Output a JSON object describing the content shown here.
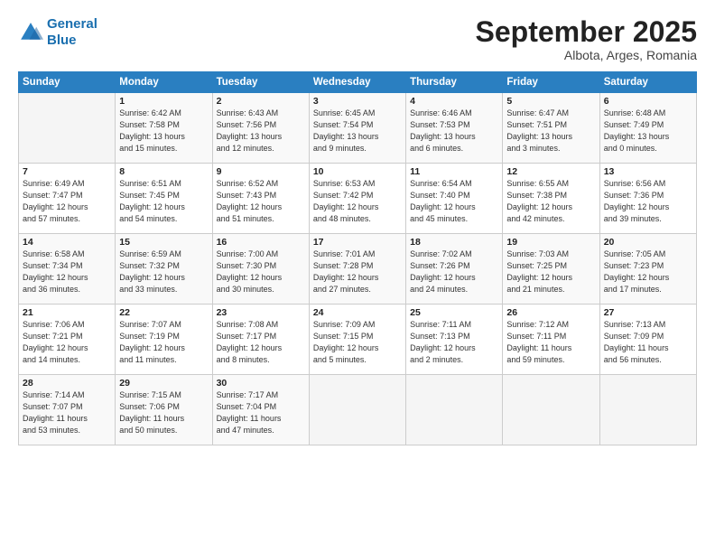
{
  "header": {
    "logo_line1": "General",
    "logo_line2": "Blue",
    "month": "September 2025",
    "location": "Albota, Arges, Romania"
  },
  "weekdays": [
    "Sunday",
    "Monday",
    "Tuesday",
    "Wednesday",
    "Thursday",
    "Friday",
    "Saturday"
  ],
  "weeks": [
    [
      {
        "day": "",
        "info": ""
      },
      {
        "day": "1",
        "info": "Sunrise: 6:42 AM\nSunset: 7:58 PM\nDaylight: 13 hours\nand 15 minutes."
      },
      {
        "day": "2",
        "info": "Sunrise: 6:43 AM\nSunset: 7:56 PM\nDaylight: 13 hours\nand 12 minutes."
      },
      {
        "day": "3",
        "info": "Sunrise: 6:45 AM\nSunset: 7:54 PM\nDaylight: 13 hours\nand 9 minutes."
      },
      {
        "day": "4",
        "info": "Sunrise: 6:46 AM\nSunset: 7:53 PM\nDaylight: 13 hours\nand 6 minutes."
      },
      {
        "day": "5",
        "info": "Sunrise: 6:47 AM\nSunset: 7:51 PM\nDaylight: 13 hours\nand 3 minutes."
      },
      {
        "day": "6",
        "info": "Sunrise: 6:48 AM\nSunset: 7:49 PM\nDaylight: 13 hours\nand 0 minutes."
      }
    ],
    [
      {
        "day": "7",
        "info": "Sunrise: 6:49 AM\nSunset: 7:47 PM\nDaylight: 12 hours\nand 57 minutes."
      },
      {
        "day": "8",
        "info": "Sunrise: 6:51 AM\nSunset: 7:45 PM\nDaylight: 12 hours\nand 54 minutes."
      },
      {
        "day": "9",
        "info": "Sunrise: 6:52 AM\nSunset: 7:43 PM\nDaylight: 12 hours\nand 51 minutes."
      },
      {
        "day": "10",
        "info": "Sunrise: 6:53 AM\nSunset: 7:42 PM\nDaylight: 12 hours\nand 48 minutes."
      },
      {
        "day": "11",
        "info": "Sunrise: 6:54 AM\nSunset: 7:40 PM\nDaylight: 12 hours\nand 45 minutes."
      },
      {
        "day": "12",
        "info": "Sunrise: 6:55 AM\nSunset: 7:38 PM\nDaylight: 12 hours\nand 42 minutes."
      },
      {
        "day": "13",
        "info": "Sunrise: 6:56 AM\nSunset: 7:36 PM\nDaylight: 12 hours\nand 39 minutes."
      }
    ],
    [
      {
        "day": "14",
        "info": "Sunrise: 6:58 AM\nSunset: 7:34 PM\nDaylight: 12 hours\nand 36 minutes."
      },
      {
        "day": "15",
        "info": "Sunrise: 6:59 AM\nSunset: 7:32 PM\nDaylight: 12 hours\nand 33 minutes."
      },
      {
        "day": "16",
        "info": "Sunrise: 7:00 AM\nSunset: 7:30 PM\nDaylight: 12 hours\nand 30 minutes."
      },
      {
        "day": "17",
        "info": "Sunrise: 7:01 AM\nSunset: 7:28 PM\nDaylight: 12 hours\nand 27 minutes."
      },
      {
        "day": "18",
        "info": "Sunrise: 7:02 AM\nSunset: 7:26 PM\nDaylight: 12 hours\nand 24 minutes."
      },
      {
        "day": "19",
        "info": "Sunrise: 7:03 AM\nSunset: 7:25 PM\nDaylight: 12 hours\nand 21 minutes."
      },
      {
        "day": "20",
        "info": "Sunrise: 7:05 AM\nSunset: 7:23 PM\nDaylight: 12 hours\nand 17 minutes."
      }
    ],
    [
      {
        "day": "21",
        "info": "Sunrise: 7:06 AM\nSunset: 7:21 PM\nDaylight: 12 hours\nand 14 minutes."
      },
      {
        "day": "22",
        "info": "Sunrise: 7:07 AM\nSunset: 7:19 PM\nDaylight: 12 hours\nand 11 minutes."
      },
      {
        "day": "23",
        "info": "Sunrise: 7:08 AM\nSunset: 7:17 PM\nDaylight: 12 hours\nand 8 minutes."
      },
      {
        "day": "24",
        "info": "Sunrise: 7:09 AM\nSunset: 7:15 PM\nDaylight: 12 hours\nand 5 minutes."
      },
      {
        "day": "25",
        "info": "Sunrise: 7:11 AM\nSunset: 7:13 PM\nDaylight: 12 hours\nand 2 minutes."
      },
      {
        "day": "26",
        "info": "Sunrise: 7:12 AM\nSunset: 7:11 PM\nDaylight: 11 hours\nand 59 minutes."
      },
      {
        "day": "27",
        "info": "Sunrise: 7:13 AM\nSunset: 7:09 PM\nDaylight: 11 hours\nand 56 minutes."
      }
    ],
    [
      {
        "day": "28",
        "info": "Sunrise: 7:14 AM\nSunset: 7:07 PM\nDaylight: 11 hours\nand 53 minutes."
      },
      {
        "day": "29",
        "info": "Sunrise: 7:15 AM\nSunset: 7:06 PM\nDaylight: 11 hours\nand 50 minutes."
      },
      {
        "day": "30",
        "info": "Sunrise: 7:17 AM\nSunset: 7:04 PM\nDaylight: 11 hours\nand 47 minutes."
      },
      {
        "day": "",
        "info": ""
      },
      {
        "day": "",
        "info": ""
      },
      {
        "day": "",
        "info": ""
      },
      {
        "day": "",
        "info": ""
      }
    ]
  ]
}
